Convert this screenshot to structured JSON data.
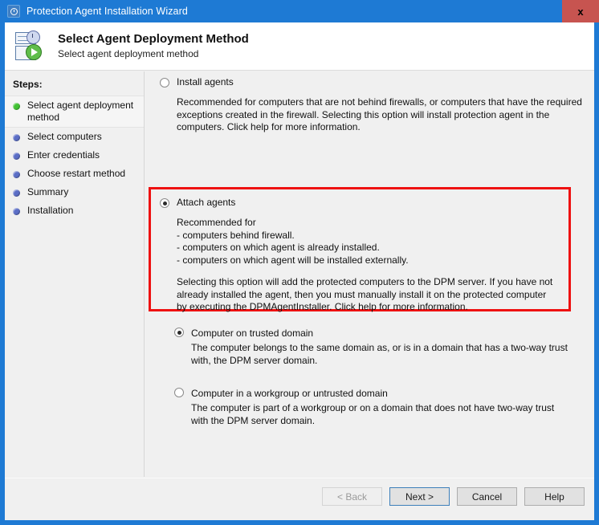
{
  "window": {
    "title": "Protection Agent Installation Wizard",
    "icon": "clock-icon",
    "close_label": "x"
  },
  "header": {
    "title": "Select Agent Deployment Method",
    "subtitle": "Select agent deployment method",
    "icon": "deployment-wizard-icon"
  },
  "sidebar": {
    "label": "Steps:",
    "items": [
      {
        "label": "Select agent deployment method",
        "state": "active",
        "bullet_color": "#42c234"
      },
      {
        "label": "Select computers",
        "state": "pending",
        "bullet_color": "#5b6ec6"
      },
      {
        "label": "Enter credentials",
        "state": "pending",
        "bullet_color": "#5b6ec6"
      },
      {
        "label": "Choose restart method",
        "state": "pending",
        "bullet_color": "#5b6ec6"
      },
      {
        "label": "Summary",
        "state": "pending",
        "bullet_color": "#5b6ec6"
      },
      {
        "label": "Installation",
        "state": "pending",
        "bullet_color": "#5b6ec6"
      }
    ]
  },
  "main": {
    "install_option": {
      "label": "Install agents",
      "selected": false,
      "description": "Recommended for computers that are not behind firewalls, or computers that have the required exceptions created in the firewall. Selecting this option will install protection agent in the computers. Click help for more information."
    },
    "attach_option": {
      "label": "Attach agents",
      "selected": true,
      "highlight_color": "#ee1111",
      "description_1": "Recommended for\n- computers behind firewall.\n- computers on which agent is already installed.\n- computers on which agent will be installed externally.",
      "description_2": "Selecting this option will add the protected computers to the DPM server. If you have not already installed the agent, then you must manually install it on the protected computer by executing the DPMAgentInstaller. Click help for more information."
    },
    "sub_options": [
      {
        "label": "Computer on trusted domain",
        "selected": true,
        "description": "The computer belongs to the same domain as, or is in a domain that has a two-way trust with, the DPM server domain."
      },
      {
        "label": "Computer in a workgroup or untrusted domain",
        "selected": false,
        "description": "The computer is part of a workgroup or on a domain that does not have two-way trust with the DPM server domain."
      }
    ]
  },
  "footer": {
    "buttons": [
      {
        "label": "< Back",
        "state": "disabled"
      },
      {
        "label": "Next >",
        "state": "default"
      },
      {
        "label": "Cancel",
        "state": "normal"
      },
      {
        "label": "Help",
        "state": "normal"
      }
    ]
  }
}
